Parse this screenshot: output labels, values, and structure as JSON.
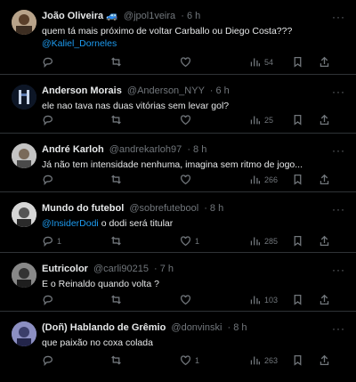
{
  "tweets": [
    {
      "name": "João Oliveira 🚙",
      "handle": "@jpol1veira",
      "time": "· 6 h",
      "text": "quem tá mais próximo de voltar Carballo ou Diego Costa???",
      "mention_line": "@Kaliel_Dorneles",
      "replies": "",
      "retweets": "",
      "likes": "",
      "views": "54",
      "avatar_color": "#8a7560"
    },
    {
      "name": "Anderson Morais",
      "handle": "@Anderson_NYY",
      "time": "· 6 h",
      "text": "ele nao tava nas duas vitórias sem levar gol?",
      "replies": "",
      "retweets": "",
      "likes": "",
      "views": "25",
      "avatar_color": "#1a2a44"
    },
    {
      "name": "André Karloh",
      "handle": "@andrekarloh97",
      "time": "· 8 h",
      "text": "Já não tem intensidade nenhuma, imagina sem ritmo de jogo...",
      "replies": "",
      "retweets": "",
      "likes": "",
      "views": "266",
      "avatar_color": "#9a9a9a"
    },
    {
      "name": "Mundo do futebol",
      "handle": "@sobrefutebool",
      "time": "· 8 h",
      "mention": "@InsiderDodi",
      "text_after": " o dodi será titular",
      "replies": "1",
      "retweets": "",
      "likes": "1",
      "views": "285",
      "avatar_color": "#b0b0b0"
    },
    {
      "name": "Eutricolor",
      "handle": "@carli90215",
      "time": "· 7 h",
      "text": "E o Reinaldo quando volta ?",
      "replies": "",
      "retweets": "",
      "likes": "",
      "views": "103",
      "avatar_color": "#6a6a6a"
    },
    {
      "name": "(Doñ) Hablando de Grêmio",
      "handle": "@donvinski",
      "time": "· 8 h",
      "text": "que paixão no coxa colada",
      "replies": "",
      "retweets": "",
      "likes": "1",
      "views": "263",
      "avatar_color": "#6b6f9a"
    }
  ]
}
